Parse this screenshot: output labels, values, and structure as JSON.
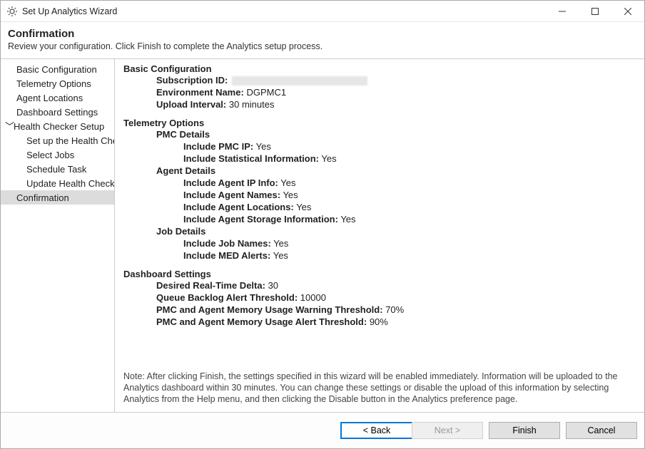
{
  "window": {
    "title": "Set Up Analytics Wizard"
  },
  "header": {
    "title": "Confirmation",
    "subtitle": "Review your configuration. Click Finish to complete the Analytics setup process."
  },
  "nav": {
    "items": [
      {
        "label": "Basic Configuration"
      },
      {
        "label": "Telemetry Options"
      },
      {
        "label": "Agent Locations"
      },
      {
        "label": "Dashboard Settings"
      },
      {
        "label": "Health Checker Setup",
        "expandable": true
      },
      {
        "label": "Set up the Health Checker",
        "child": true
      },
      {
        "label": "Select Jobs",
        "child": true
      },
      {
        "label": "Schedule Task",
        "child": true
      },
      {
        "label": "Update Health Checker",
        "child": true
      },
      {
        "label": "Confirmation",
        "selected": true
      }
    ]
  },
  "sections": {
    "basic": {
      "title": "Basic Configuration",
      "subscription_label": "Subscription ID:",
      "subscription_value": "",
      "env_label": "Environment Name:",
      "env_value": "DGPMC1",
      "interval_label": "Upload Interval:",
      "interval_value": "30 minutes"
    },
    "telemetry": {
      "title": "Telemetry Options",
      "pmc_title": "PMC Details",
      "pmc_ip_label": "Include PMC IP:",
      "pmc_ip_value": "Yes",
      "stat_label": "Include Statistical Information:",
      "stat_value": "Yes",
      "agent_title": "Agent Details",
      "agent_ip_label": "Include Agent IP Info:",
      "agent_ip_value": "Yes",
      "agent_names_label": "Include Agent Names:",
      "agent_names_value": "Yes",
      "agent_loc_label": "Include Agent Locations:",
      "agent_loc_value": "Yes",
      "agent_storage_label": "Include Agent Storage Information:",
      "agent_storage_value": "Yes",
      "job_title": "Job Details",
      "job_names_label": "Include Job Names:",
      "job_names_value": "Yes",
      "med_label": "Include MED Alerts:",
      "med_value": "Yes"
    },
    "dashboard": {
      "title": "Dashboard Settings",
      "delta_label": "Desired Real-Time Delta:",
      "delta_value": "30",
      "queue_label": "Queue Backlog Alert Threshold:",
      "queue_value": "10000",
      "warn_label": "PMC and Agent Memory Usage Warning Threshold:",
      "warn_value": "70%",
      "alert_label": "PMC and Agent Memory Usage Alert Threshold:",
      "alert_value": "90%"
    }
  },
  "note": "Note: After clicking Finish, the settings specified in this wizard will be enabled immediately. Information will be uploaded to the Analytics dashboard within 30 minutes. You can change these settings or disable the upload of this information by selecting Analytics from the Help menu, and then clicking the Disable button in the Analytics preference page.",
  "footer": {
    "back": "< Back",
    "next": "Next >",
    "finish": "Finish",
    "cancel": "Cancel"
  }
}
